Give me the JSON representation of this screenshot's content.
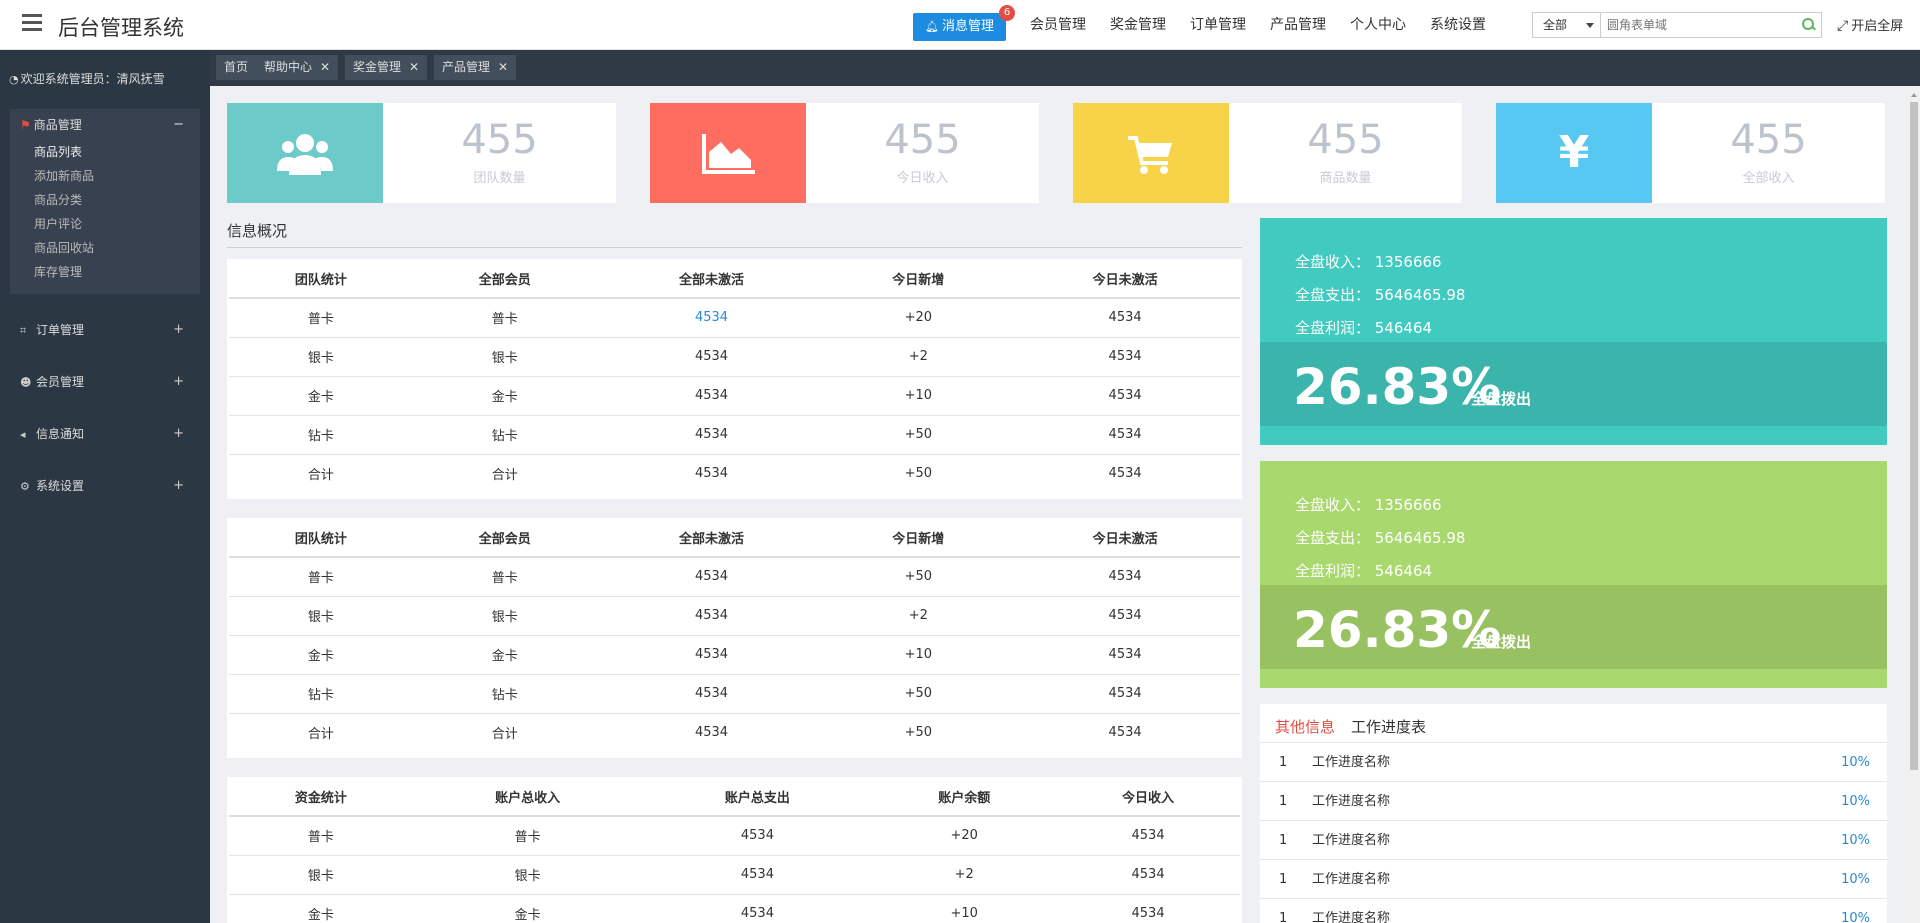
{
  "header": {
    "brand": "后台管理系统",
    "msg_button": "消息管理",
    "msg_badge": "6",
    "nav": [
      "会员管理",
      "奖金管理",
      "订单管理",
      "产品管理",
      "个人中心",
      "系统设置"
    ],
    "search_select": "全部",
    "search_placeholder": "圆角表单域",
    "fullscreen": "开启全屏"
  },
  "sidebar": {
    "welcome": "欢迎系统管理员：清风抚雪",
    "open_group": "商品管理",
    "open_sign": "−",
    "sub_items": [
      "商品列表",
      "添加新商品",
      "商品分类",
      "用户评论",
      "商品回收站",
      "库存管理"
    ],
    "groups": [
      {
        "label": "订单管理",
        "sign": "+"
      },
      {
        "label": "会员管理",
        "sign": "+"
      },
      {
        "label": "信息通知",
        "sign": "+"
      },
      {
        "label": "系统设置",
        "sign": "+"
      }
    ]
  },
  "tabs": [
    {
      "label": "首页",
      "closable": false
    },
    {
      "label": "帮助中心",
      "closable": true
    },
    {
      "label": "奖金管理",
      "closable": true
    },
    {
      "label": "产品管理",
      "closable": true
    }
  ],
  "stats": [
    {
      "value": "455",
      "label": "团队数量",
      "color": "#6ccac9",
      "icon": "users-icon"
    },
    {
      "value": "455",
      "label": "今日收入",
      "color": "#ff6c60",
      "icon": "area-chart-icon"
    },
    {
      "value": "455",
      "label": "商品数量",
      "color": "#f8d347",
      "icon": "cart-icon"
    },
    {
      "value": "455",
      "label": "全部收入",
      "color": "#57c8f2",
      "icon": "yen-icon"
    }
  ],
  "section_title": "信息概况",
  "tables": [
    {
      "headers": [
        "团队统计",
        "全部会员",
        "全部未激活",
        "今日新增",
        "今日未激活"
      ],
      "rows": [
        [
          "普卡",
          "普卡",
          "4534",
          "+20",
          "4534"
        ],
        [
          "银卡",
          "银卡",
          "4534",
          "+2",
          "4534"
        ],
        [
          "金卡",
          "金卡",
          "4534",
          "+10",
          "4534"
        ],
        [
          "钻卡",
          "钻卡",
          "4534",
          "+50",
          "4534"
        ],
        [
          "合计",
          "合计",
          "4534",
          "+50",
          "4534"
        ]
      ]
    },
    {
      "headers": [
        "团队统计",
        "全部会员",
        "全部未激活",
        "今日新增",
        "今日未激活"
      ],
      "rows": [
        [
          "普卡",
          "普卡",
          "4534",
          "+50",
          "4534"
        ],
        [
          "银卡",
          "银卡",
          "4534",
          "+2",
          "4534"
        ],
        [
          "金卡",
          "金卡",
          "4534",
          "+10",
          "4534"
        ],
        [
          "钻卡",
          "钻卡",
          "4534",
          "+50",
          "4534"
        ],
        [
          "合计",
          "合计",
          "4534",
          "+50",
          "4534"
        ]
      ]
    },
    {
      "headers": [
        "资金统计",
        "账户总收入",
        "账户总支出",
        "账户余额",
        "今日收入"
      ],
      "rows": [
        [
          "普卡",
          "普卡",
          "4534",
          "+20",
          "4534"
        ],
        [
          "银卡",
          "银卡",
          "4534",
          "+2",
          "4534"
        ],
        [
          "金卡",
          "金卡",
          "4534",
          "+10",
          "4534"
        ]
      ]
    }
  ],
  "panels": [
    {
      "bg": "#41cac0",
      "band": "#3bb5ab",
      "lines": [
        "全盘收入： 1356666",
        "全盘支出： 5646465.98",
        "全盘利润： 546464"
      ],
      "percent": "26.83%",
      "percent_label": "全盘拨出"
    },
    {
      "bg": "#a9d86e",
      "band": "#98c262",
      "lines": [
        "全盘收入： 1356666",
        "全盘支出： 5646465.98",
        "全盘利润： 546464"
      ],
      "percent": "26.83%",
      "percent_label": "全盘拨出"
    }
  ],
  "list": {
    "tabs": [
      "其他信息",
      "工作进度表"
    ],
    "rows": [
      {
        "no": "1",
        "name": "工作进度名称",
        "pct": "10%"
      },
      {
        "no": "1",
        "name": "工作进度名称",
        "pct": "10%"
      },
      {
        "no": "1",
        "name": "工作进度名称",
        "pct": "10%"
      },
      {
        "no": "1",
        "name": "工作进度名称",
        "pct": "10%"
      },
      {
        "no": "1",
        "name": "工作进度名称",
        "pct": "10%"
      }
    ]
  }
}
